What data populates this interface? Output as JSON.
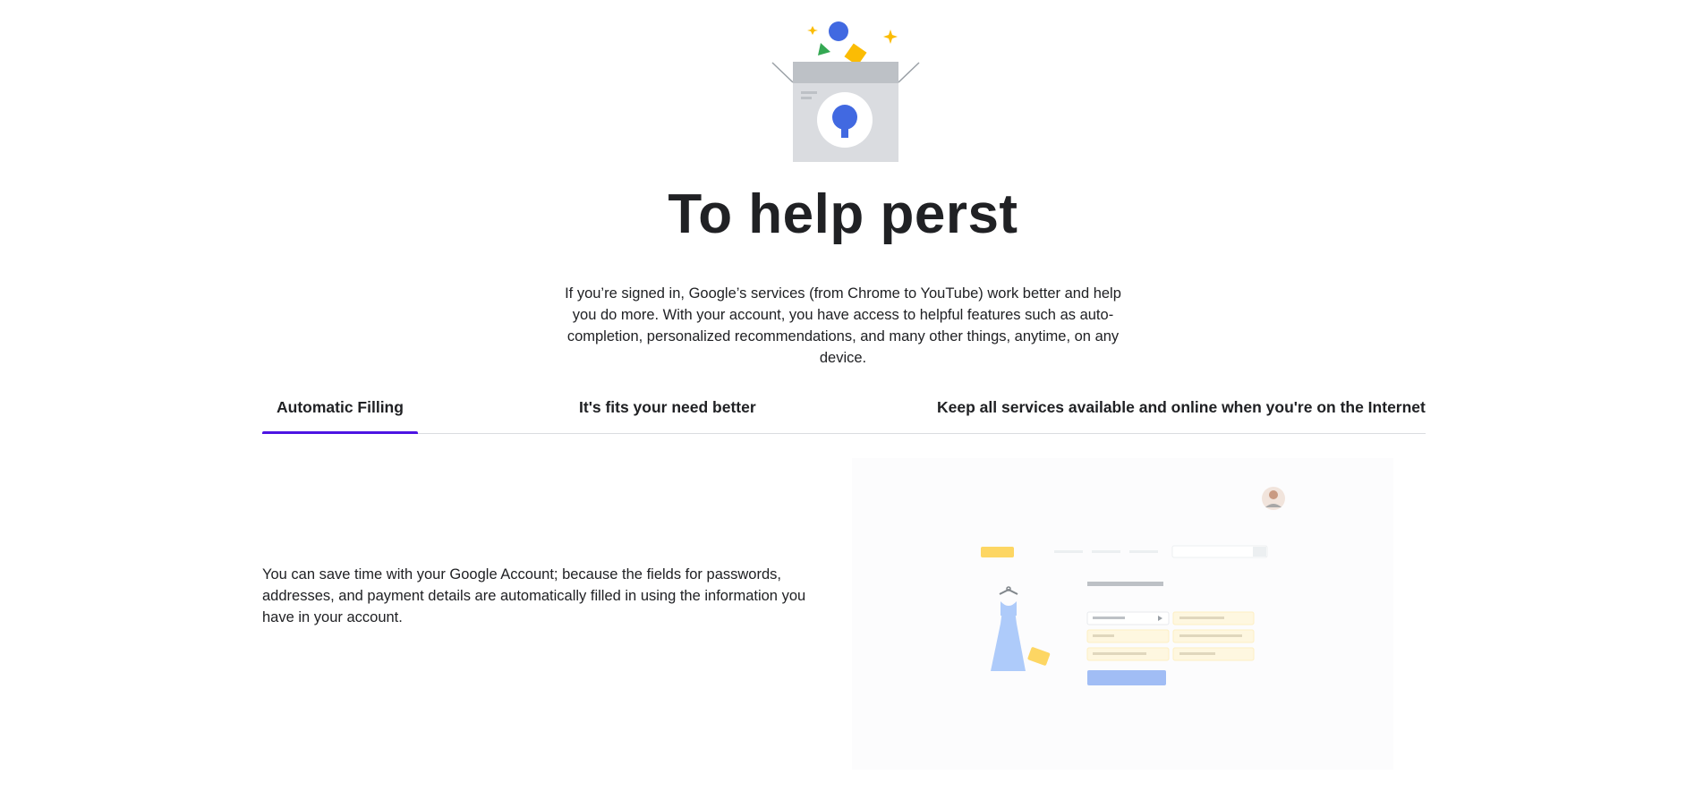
{
  "hero": {
    "headline": "To help perst",
    "intro": "If you’re signed in, Google’s services (from Chrome to YouTube) work better and help you do more. With your account, you have access to helpful features such as auto-completion, personalized recommendations, and many other things, anytime, on any device."
  },
  "tabs": [
    {
      "label": "Automatic Filling",
      "active": true
    },
    {
      "label": "It's fits your need better",
      "active": false
    },
    {
      "label": "Keep all services available and online when you're on the Internet",
      "active": false
    }
  ],
  "panel": {
    "text": "You can save time with your Google Account; because the fields for passwords, addresses, and payment details are automatically filled in using the information you have in your account."
  },
  "colors": {
    "tab_indicator": "#4d14e3",
    "brand_blue": "#4169e1",
    "brand_yellow": "#fbbc04",
    "brand_green": "#34a853"
  }
}
